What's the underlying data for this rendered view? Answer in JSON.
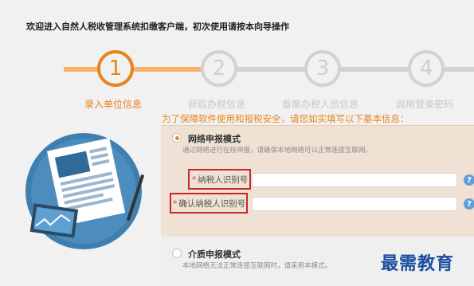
{
  "header": {
    "title": "欢迎进入自然人税收管理系统扣缴客户端，初次使用请按本向导操作"
  },
  "steps": [
    {
      "number": "1",
      "label": "录入单位信息",
      "active": true
    },
    {
      "number": "2",
      "label": "获取办税信息",
      "active": false
    },
    {
      "number": "3",
      "label": "备案办税人员信息",
      "active": false
    },
    {
      "number": "4",
      "label": "启用登录密码",
      "active": false
    }
  ],
  "form": {
    "notice": "为了保障软件使用和报税安全，请您如实填写以下基本信息：",
    "online_mode": {
      "title": "网络申报模式",
      "description": "通过网络进行在线申报，请确保本地网络可以正常连接互联网。",
      "selected": true
    },
    "taxpayer_id_label": "纳税人识别号",
    "taxpayer_id_value": "",
    "confirm_taxpayer_id_label": "确认纳税人识别号",
    "confirm_taxpayer_id_value": "",
    "required_mark": "*",
    "help_glyph": "?",
    "media_mode": {
      "title": "介质申报模式",
      "description": "本地网络无法正常连接互联网时，请采用本模式。",
      "selected": false
    }
  },
  "watermark": "最需教育",
  "colors": {
    "accent": "#e8841b",
    "highlight_box": "#c62828",
    "help_icon": "#5f9ed6",
    "watermark": "#1c4fa0"
  }
}
